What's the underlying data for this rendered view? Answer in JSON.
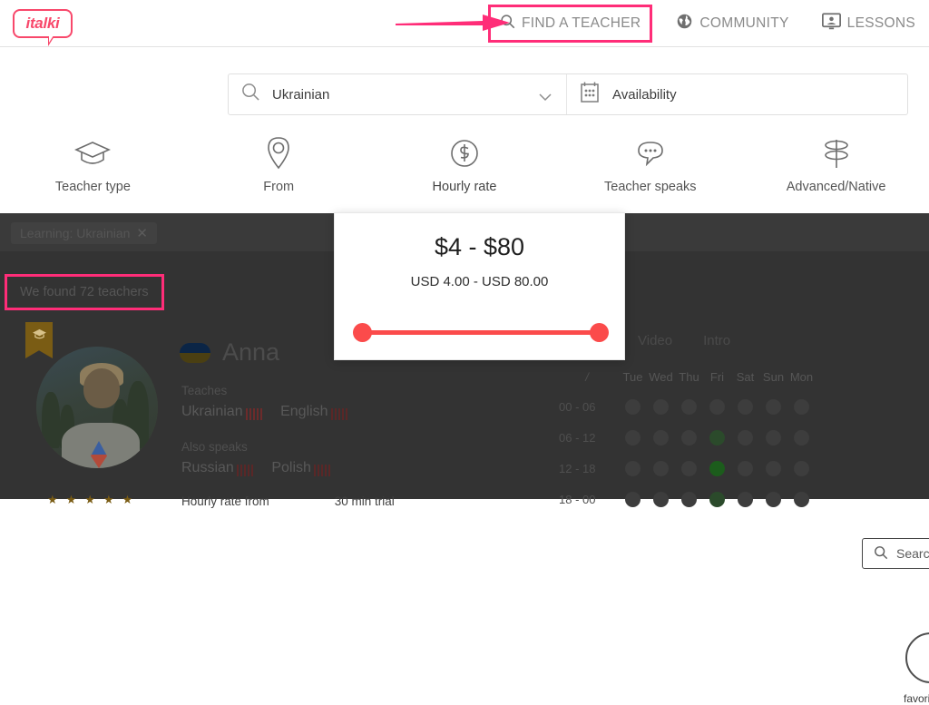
{
  "brand": {
    "logo_text": "italki",
    "accent_pink": "#ff2d78",
    "accent_red": "#fb4b4b"
  },
  "header": {
    "nav": [
      {
        "label": "FIND A TEACHER",
        "icon": "search-icon",
        "highlighted": true
      },
      {
        "label": "COMMUNITY",
        "icon": "globe-icon",
        "highlighted": false
      },
      {
        "label": "LESSONS",
        "icon": "lessons-icon",
        "highlighted": false
      }
    ]
  },
  "search": {
    "language_value": "Ukrainian",
    "language_icon": "search-icon",
    "dropdown_icon": "chevron-down-icon",
    "availability_label": "Availability",
    "availability_icon": "calendar-icon"
  },
  "filters": [
    {
      "label": "Teacher type",
      "icon": "graduation-cap-icon",
      "active": false
    },
    {
      "label": "From",
      "icon": "location-pin-icon",
      "active": false
    },
    {
      "label": "Hourly rate",
      "icon": "dollar-circle-icon",
      "active": true
    },
    {
      "label": "Teacher speaks",
      "icon": "speech-bubble-icon",
      "active": false
    },
    {
      "label": "Advanced/Native",
      "icon": "signpost-icon",
      "active": false
    }
  ],
  "hourly_rate_popover": {
    "range_title": "$4 - $80",
    "range_subtitle": "USD 4.00 - USD 80.00",
    "slider_min_label": "USD 4.00",
    "slider_max_label": "USD 80.00"
  },
  "results": {
    "chip_label": "Learning: Ukrainian",
    "chip_close_icon": "close-icon",
    "found_text": "We found 72 teachers",
    "side_search_placeholder": "Search",
    "side_search_icon": "search-icon",
    "history_icon": "clock-icon",
    "history_label": "favorite"
  },
  "teacher": {
    "name": "Anna",
    "country_flag": "ukraine-flag",
    "badge_icon": "graduation-cap-icon",
    "teaches_label": "Teaches",
    "teaches": [
      {
        "language": "Ukrainian",
        "level": 5
      },
      {
        "language": "English",
        "level": 5
      }
    ],
    "also_speaks_label": "Also speaks",
    "also_speaks": [
      {
        "language": "Russian",
        "level": 5
      },
      {
        "language": "Polish",
        "level": 5
      }
    ],
    "rating_stars": 5,
    "hourly_rate_label": "Hourly rate from",
    "trial_label": "30 min trial"
  },
  "availability": {
    "tabs": [
      "Video",
      "Intro"
    ],
    "corner_label": "/",
    "days": [
      "Tue",
      "Wed",
      "Thu",
      "Fri",
      "Sat",
      "Sun",
      "Mon"
    ],
    "time_rows": [
      "00 - 06",
      "06 - 12",
      "12 - 18",
      "18 - 00"
    ],
    "grid": [
      [
        0,
        0,
        0,
        0,
        0,
        0,
        0
      ],
      [
        0,
        0,
        0,
        1,
        0,
        0,
        0
      ],
      [
        0,
        0,
        0,
        2,
        0,
        0,
        0
      ],
      [
        0,
        0,
        0,
        1,
        0,
        0,
        0
      ]
    ]
  }
}
